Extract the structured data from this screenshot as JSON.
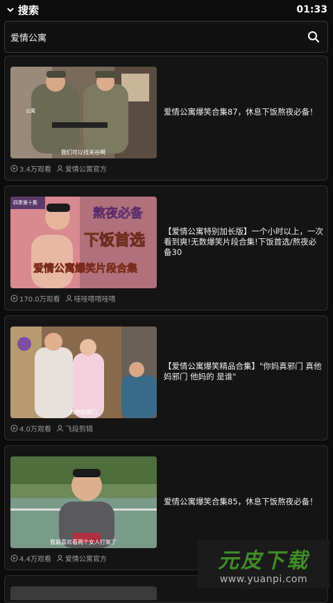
{
  "header": {
    "title": "搜索",
    "time": "01:33",
    "back_icon": "chevron-down-icon"
  },
  "search": {
    "value": "爱情公寓",
    "icon": "search-icon"
  },
  "results": [
    {
      "description": "爱情公寓爆笑合集87，休息下饭熬夜必备！",
      "views": "3.4万观看",
      "author": "爱情公寓官方",
      "thumb_caption": "我们可以找关谷啊",
      "thumb_label": "公寓"
    },
    {
      "description": "【爱情公寓特别加长版】一个小时以上，一次看到爽!无数爆笑片段合集!下饭首选/熬夜必备30",
      "views": "170.0万观看",
      "author": "哇哇嘻嘻哇嘻",
      "thumb_line1": "熬夜必备",
      "thumb_line2": "下饭首选",
      "thumb_line3": "爱情公寓爆笑片段合集",
      "thumb_tag": "四季第十集"
    },
    {
      "description": "【爱情公寓爆笑精品合集】\"你妈真邪门 真他妈邪门 他妈的 是谁\"",
      "views": "4.0万观看",
      "author": "飞段剪辑",
      "thumb_caption": "真他妈邪门"
    },
    {
      "description": "爱情公寓爆笑合集85，休息下饭熬夜必备！",
      "views": "4.4万观看",
      "author": "爱情公寓官方",
      "thumb_caption": "我最喜欢看两个女人打架了"
    }
  ],
  "watermark": {
    "line1": "元皮下载",
    "line2": "www.yuanpi.com"
  },
  "colors": {
    "background": "#0b0b0b",
    "card": "#141414",
    "meta": "#9a9a9a",
    "watermark_green": "#3f8d28"
  }
}
